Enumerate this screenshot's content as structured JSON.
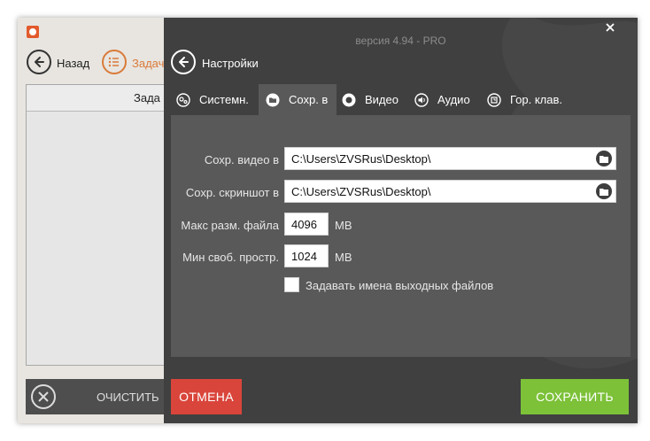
{
  "background_window": {
    "back_label": "Назад",
    "tasks_label": "Задач",
    "tasks_header": "Зада",
    "clear_label": "ОЧИСТИТЬ"
  },
  "dialog": {
    "version": "версия 4.94 - PRO",
    "title": "Настройки",
    "tabs": [
      {
        "label": "Системн.",
        "icon": "gears-icon",
        "active": false
      },
      {
        "label": "Сохр. в",
        "icon": "folder-icon",
        "active": true
      },
      {
        "label": "Видео",
        "icon": "record-icon",
        "active": false
      },
      {
        "label": "Аудио",
        "icon": "speaker-icon",
        "active": false
      },
      {
        "label": "Гор. клав.",
        "icon": "keyboard-icon",
        "active": false
      }
    ],
    "save_video": {
      "label": "Сохр. видео в",
      "value": "C:\\Users\\ZVSRus\\Desktop\\"
    },
    "save_screenshot": {
      "label": "Сохр. скриншот в",
      "value": "C:\\Users\\ZVSRus\\Desktop\\"
    },
    "max_file_size": {
      "label": "Макс разм. файла",
      "value": "4096",
      "unit": "MB"
    },
    "min_free_space": {
      "label": "Мин своб. простр.",
      "value": "1024",
      "unit": "MB"
    },
    "custom_names": {
      "label": "Задавать имена выходных файлов",
      "checked": false
    },
    "cancel_label": "ОТМЕНА",
    "save_label": "СОХРАНИТЬ"
  },
  "colors": {
    "dialog_bg": "#404040",
    "panel_bg": "#595959",
    "cancel": "#d9453b",
    "save": "#7cc138",
    "accent_orange": "#d97a3a"
  }
}
